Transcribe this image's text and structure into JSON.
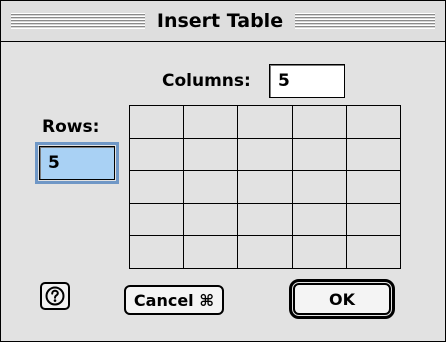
{
  "dialog": {
    "title": "Insert Table",
    "columns_label": "Columns:",
    "columns_value": "5",
    "rows_label": "Rows:",
    "rows_value": "5",
    "grid_preview": {
      "columns": 5,
      "rows": 5
    },
    "help_icon": "help-icon",
    "cancel_label": "Cancel ⌘",
    "ok_label": "OK"
  }
}
